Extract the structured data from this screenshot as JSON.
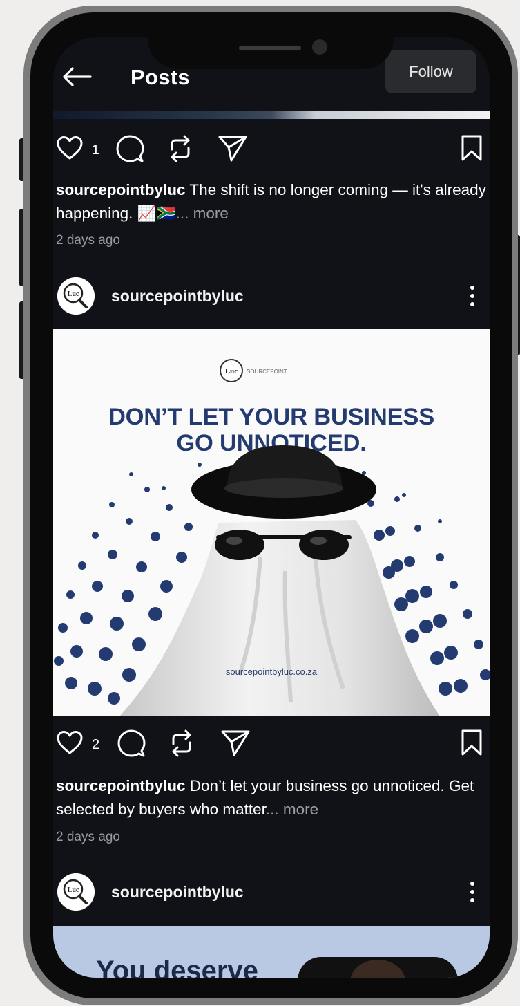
{
  "header": {
    "title": "Posts",
    "follow_label": "Follow"
  },
  "post1": {
    "likes": "1",
    "username": "sourcepointbyluc",
    "caption_text": " The shift is no longer coming — it's already happening. 📈🇿🇦",
    "more": "... more",
    "time": "2 days ago"
  },
  "post2": {
    "username": "sourcepointbyluc",
    "image": {
      "logo_text": "Luc",
      "brand_text": "SOURCEPOINT",
      "headline_line1": "DON’T LET YOUR BUSINESS",
      "headline_line2": "GO UNNOTICED.",
      "url": "sourcepointbyluc.co.za"
    },
    "likes": "2",
    "caption_text": " Don’t let your business go unnoticed. Get selected by buyers who matter",
    "more": "... more",
    "time": "2 days ago"
  },
  "post3": {
    "username": "sourcepointbyluc",
    "image_text": "You deserve"
  },
  "avatar_text": "Luc",
  "icons": [
    "back-arrow-icon",
    "heart-icon",
    "comment-icon",
    "repost-icon",
    "share-icon",
    "bookmark-icon",
    "more-options-icon"
  ],
  "colors": {
    "background": "#101217",
    "headline": "#243b72",
    "muted": "#9a9ca2",
    "follow_bg": "#2a2b2e"
  }
}
